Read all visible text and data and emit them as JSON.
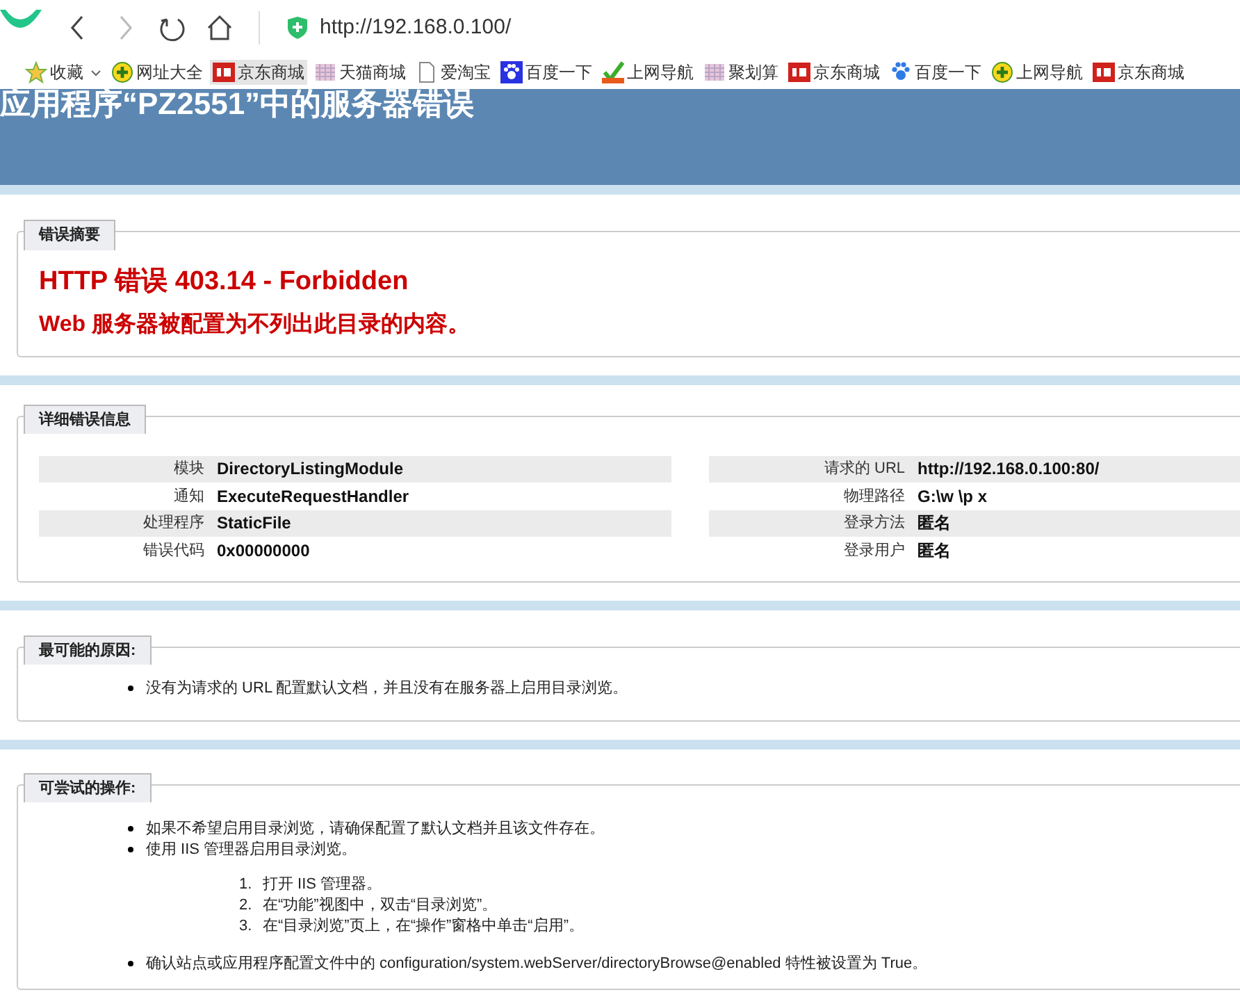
{
  "browser": {
    "url": "http://192.168.0.100/",
    "bookmarks": [
      {
        "label": "收藏",
        "kind": "star"
      },
      {
        "label": "网址大全",
        "kind": "plus"
      },
      {
        "label": "京东商城",
        "kind": "jd"
      },
      {
        "label": "天猫商城",
        "kind": "grid"
      },
      {
        "label": "爱淘宝",
        "kind": "page"
      },
      {
        "label": "百度一下",
        "kind": "paw"
      },
      {
        "label": "上网导航",
        "kind": "check"
      },
      {
        "label": "聚划算",
        "kind": "grid"
      },
      {
        "label": "京东商城",
        "kind": "jd"
      },
      {
        "label": "百度一下",
        "kind": "pawlight"
      },
      {
        "label": "上网导航",
        "kind": "plus"
      },
      {
        "label": "京东商城",
        "kind": "jd"
      }
    ]
  },
  "page": {
    "title": "应用程序“PZ2551”中的服务器错误",
    "summary": {
      "legend": "错误摘要",
      "heading": "HTTP 错误 403.14 - Forbidden",
      "message": "Web 服务器被配置为不列出此目录的内容。"
    },
    "details": {
      "legend": "详细错误信息",
      "left": [
        {
          "label": "模块",
          "value": "DirectoryListingModule"
        },
        {
          "label": "通知",
          "value": "ExecuteRequestHandler"
        },
        {
          "label": "处理程序",
          "value": "StaticFile"
        },
        {
          "label": "错误代码",
          "value": "0x00000000"
        }
      ],
      "right": [
        {
          "label": "请求的 URL",
          "value": "http://192.168.0.100:80/"
        },
        {
          "label": "物理路径",
          "value": "G:\\w \\p x"
        },
        {
          "label": "登录方法",
          "value": "匿名"
        },
        {
          "label": "登录用户",
          "value": "匿名"
        }
      ]
    },
    "causes": {
      "legend": "最可能的原因:",
      "items": [
        "没有为请求的 URL 配置默认文档，并且没有在服务器上启用目录浏览。"
      ]
    },
    "actions": {
      "legend": "可尝试的操作:",
      "items": [
        {
          "text": "如果不希望启用目录浏览，请确保配置了默认文档并且该文件存在。"
        },
        {
          "text": "使用 IIS 管理器启用目录浏览。",
          "steps": [
            {
              "number": "1.",
              "text": "打开 IIS 管理器。"
            },
            {
              "number": "2.",
              "text": "在“功能”视图中，双击“目录浏览”。"
            },
            {
              "number": "3.",
              "text": "在“目录浏览”页上，在“操作”窗格中单击“启用”。"
            }
          ]
        },
        {
          "text": "确认站点或应用程序配置文件中的 configuration/system.webServer/directoryBrowse@enabled 特性被设置为 True。"
        }
      ]
    }
  }
}
